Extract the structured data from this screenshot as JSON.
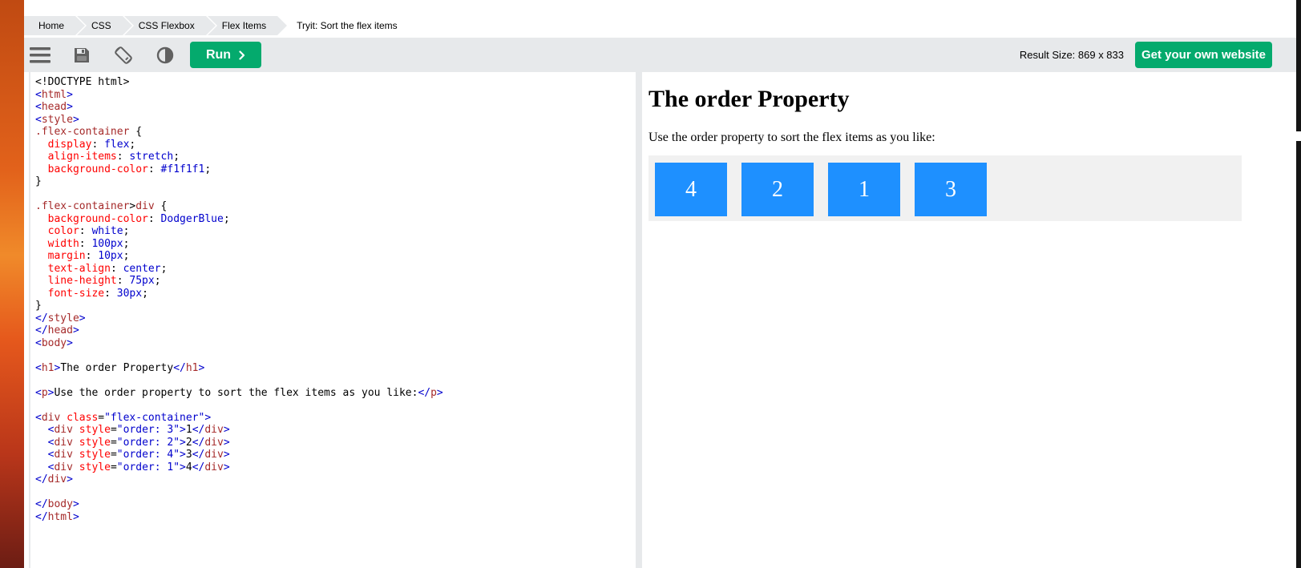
{
  "breadcrumbs": [
    "Home",
    "CSS",
    "CSS Flexbox",
    "Flex Items"
  ],
  "breadcrumb_current": "Tryit: Sort the flex items",
  "toolbar": {
    "menu_icon": "menu-icon",
    "save_icon": "save-icon",
    "rotate_icon": "rotate-icon",
    "theme_icon": "contrast-icon",
    "run_label": "Run",
    "result_size": "Result Size: 869 x 833",
    "get_website_label": "Get your own website",
    "accent_color": "#04aa6d"
  },
  "code_lines": [
    [
      [
        "t",
        "<!DOCTYPE html>"
      ]
    ],
    [
      [
        "p",
        "<"
      ],
      [
        "tg",
        "html"
      ],
      [
        "p",
        ">"
      ]
    ],
    [
      [
        "p",
        "<"
      ],
      [
        "tg",
        "head"
      ],
      [
        "p",
        ">"
      ]
    ],
    [
      [
        "p",
        "<"
      ],
      [
        "tg",
        "style"
      ],
      [
        "p",
        ">"
      ]
    ],
    [
      [
        "sel",
        ".flex-container"
      ],
      [
        "t",
        " {"
      ]
    ],
    [
      [
        "t",
        "  "
      ],
      [
        "prop",
        "display"
      ],
      [
        "t",
        ": "
      ],
      [
        "val",
        "flex"
      ],
      [
        "t",
        ";"
      ]
    ],
    [
      [
        "t",
        "  "
      ],
      [
        "prop",
        "align-items"
      ],
      [
        "t",
        ": "
      ],
      [
        "val",
        "stretch"
      ],
      [
        "t",
        ";"
      ]
    ],
    [
      [
        "t",
        "  "
      ],
      [
        "prop",
        "background-color"
      ],
      [
        "t",
        ": "
      ],
      [
        "val",
        "#f1f1f1"
      ],
      [
        "t",
        ";"
      ]
    ],
    [
      [
        "t",
        "}"
      ]
    ],
    [
      [
        "t",
        ""
      ]
    ],
    [
      [
        "sel",
        ".flex-container"
      ],
      [
        "t",
        ">"
      ],
      [
        "sel",
        "div"
      ],
      [
        "t",
        " {"
      ]
    ],
    [
      [
        "t",
        "  "
      ],
      [
        "prop",
        "background-color"
      ],
      [
        "t",
        ": "
      ],
      [
        "val",
        "DodgerBlue"
      ],
      [
        "t",
        ";"
      ]
    ],
    [
      [
        "t",
        "  "
      ],
      [
        "prop",
        "color"
      ],
      [
        "t",
        ": "
      ],
      [
        "val",
        "white"
      ],
      [
        "t",
        ";"
      ]
    ],
    [
      [
        "t",
        "  "
      ],
      [
        "prop",
        "width"
      ],
      [
        "t",
        ": "
      ],
      [
        "val",
        "100px"
      ],
      [
        "t",
        ";"
      ]
    ],
    [
      [
        "t",
        "  "
      ],
      [
        "prop",
        "margin"
      ],
      [
        "t",
        ": "
      ],
      [
        "val",
        "10px"
      ],
      [
        "t",
        ";"
      ]
    ],
    [
      [
        "t",
        "  "
      ],
      [
        "prop",
        "text-align"
      ],
      [
        "t",
        ": "
      ],
      [
        "val",
        "center"
      ],
      [
        "t",
        ";"
      ]
    ],
    [
      [
        "t",
        "  "
      ],
      [
        "prop",
        "line-height"
      ],
      [
        "t",
        ": "
      ],
      [
        "val",
        "75px"
      ],
      [
        "t",
        ";"
      ]
    ],
    [
      [
        "t",
        "  "
      ],
      [
        "prop",
        "font-size"
      ],
      [
        "t",
        ": "
      ],
      [
        "val",
        "30px"
      ],
      [
        "t",
        ";"
      ]
    ],
    [
      [
        "t",
        "}"
      ]
    ],
    [
      [
        "p",
        "</"
      ],
      [
        "tg",
        "style"
      ],
      [
        "p",
        ">"
      ]
    ],
    [
      [
        "p",
        "</"
      ],
      [
        "tg",
        "head"
      ],
      [
        "p",
        ">"
      ]
    ],
    [
      [
        "p",
        "<"
      ],
      [
        "tg",
        "body"
      ],
      [
        "p",
        ">"
      ]
    ],
    [
      [
        "t",
        ""
      ]
    ],
    [
      [
        "p",
        "<"
      ],
      [
        "tg",
        "h1"
      ],
      [
        "p",
        ">"
      ],
      [
        "t",
        "The order Property"
      ],
      [
        "p",
        "</"
      ],
      [
        "tg",
        "h1"
      ],
      [
        "p",
        ">"
      ]
    ],
    [
      [
        "t",
        ""
      ]
    ],
    [
      [
        "p",
        "<"
      ],
      [
        "tg",
        "p"
      ],
      [
        "p",
        ">"
      ],
      [
        "t",
        "Use the order property to sort the flex items as you like:"
      ],
      [
        "p",
        "</"
      ],
      [
        "tg",
        "p"
      ],
      [
        "p",
        ">"
      ]
    ],
    [
      [
        "t",
        ""
      ]
    ],
    [
      [
        "p",
        "<"
      ],
      [
        "tg",
        "div"
      ],
      [
        "t",
        " "
      ],
      [
        "an",
        "class"
      ],
      [
        "t",
        "="
      ],
      [
        "av",
        "\"flex-container\""
      ],
      [
        "p",
        ">"
      ]
    ],
    [
      [
        "t",
        "  "
      ],
      [
        "p",
        "<"
      ],
      [
        "tg",
        "div"
      ],
      [
        "t",
        " "
      ],
      [
        "an",
        "style"
      ],
      [
        "t",
        "="
      ],
      [
        "av",
        "\"order: 3\""
      ],
      [
        "p",
        ">"
      ],
      [
        "t",
        "1"
      ],
      [
        "p",
        "</"
      ],
      [
        "tg",
        "div"
      ],
      [
        "p",
        ">"
      ]
    ],
    [
      [
        "t",
        "  "
      ],
      [
        "p",
        "<"
      ],
      [
        "tg",
        "div"
      ],
      [
        "t",
        " "
      ],
      [
        "an",
        "style"
      ],
      [
        "t",
        "="
      ],
      [
        "av",
        "\"order: 2\""
      ],
      [
        "p",
        ">"
      ],
      [
        "t",
        "2"
      ],
      [
        "p",
        "</"
      ],
      [
        "tg",
        "div"
      ],
      [
        "p",
        ">"
      ]
    ],
    [
      [
        "t",
        "  "
      ],
      [
        "p",
        "<"
      ],
      [
        "tg",
        "div"
      ],
      [
        "t",
        " "
      ],
      [
        "an",
        "style"
      ],
      [
        "t",
        "="
      ],
      [
        "av",
        "\"order: 4\""
      ],
      [
        "p",
        ">"
      ],
      [
        "t",
        "3"
      ],
      [
        "p",
        "</"
      ],
      [
        "tg",
        "div"
      ],
      [
        "p",
        ">"
      ]
    ],
    [
      [
        "t",
        "  "
      ],
      [
        "p",
        "<"
      ],
      [
        "tg",
        "div"
      ],
      [
        "t",
        " "
      ],
      [
        "an",
        "style"
      ],
      [
        "t",
        "="
      ],
      [
        "av",
        "\"order: 1\""
      ],
      [
        "p",
        ">"
      ],
      [
        "t",
        "4"
      ],
      [
        "p",
        "</"
      ],
      [
        "tg",
        "div"
      ],
      [
        "p",
        ">"
      ]
    ],
    [
      [
        "p",
        "</"
      ],
      [
        "tg",
        "div"
      ],
      [
        "p",
        ">"
      ]
    ],
    [
      [
        "t",
        ""
      ]
    ],
    [
      [
        "p",
        "</"
      ],
      [
        "tg",
        "body"
      ],
      [
        "p",
        ">"
      ]
    ],
    [
      [
        "p",
        "</"
      ],
      [
        "tg",
        "html"
      ],
      [
        "p",
        ">"
      ]
    ]
  ],
  "code_colors": {
    "p": "#0000cd",
    "tg": "#a52a2a",
    "an": "#ff0000",
    "av": "#0000cd",
    "sel": "#a52a2a",
    "prop": "#ff0000",
    "val": "#0000cd",
    "t": "#000000"
  },
  "result": {
    "heading": "The order Property",
    "paragraph": "Use the order property to sort the flex items as you like:",
    "items": [
      "4",
      "2",
      "1",
      "3"
    ],
    "item_color": "#1e90ff",
    "container_color": "#f1f1f1"
  }
}
